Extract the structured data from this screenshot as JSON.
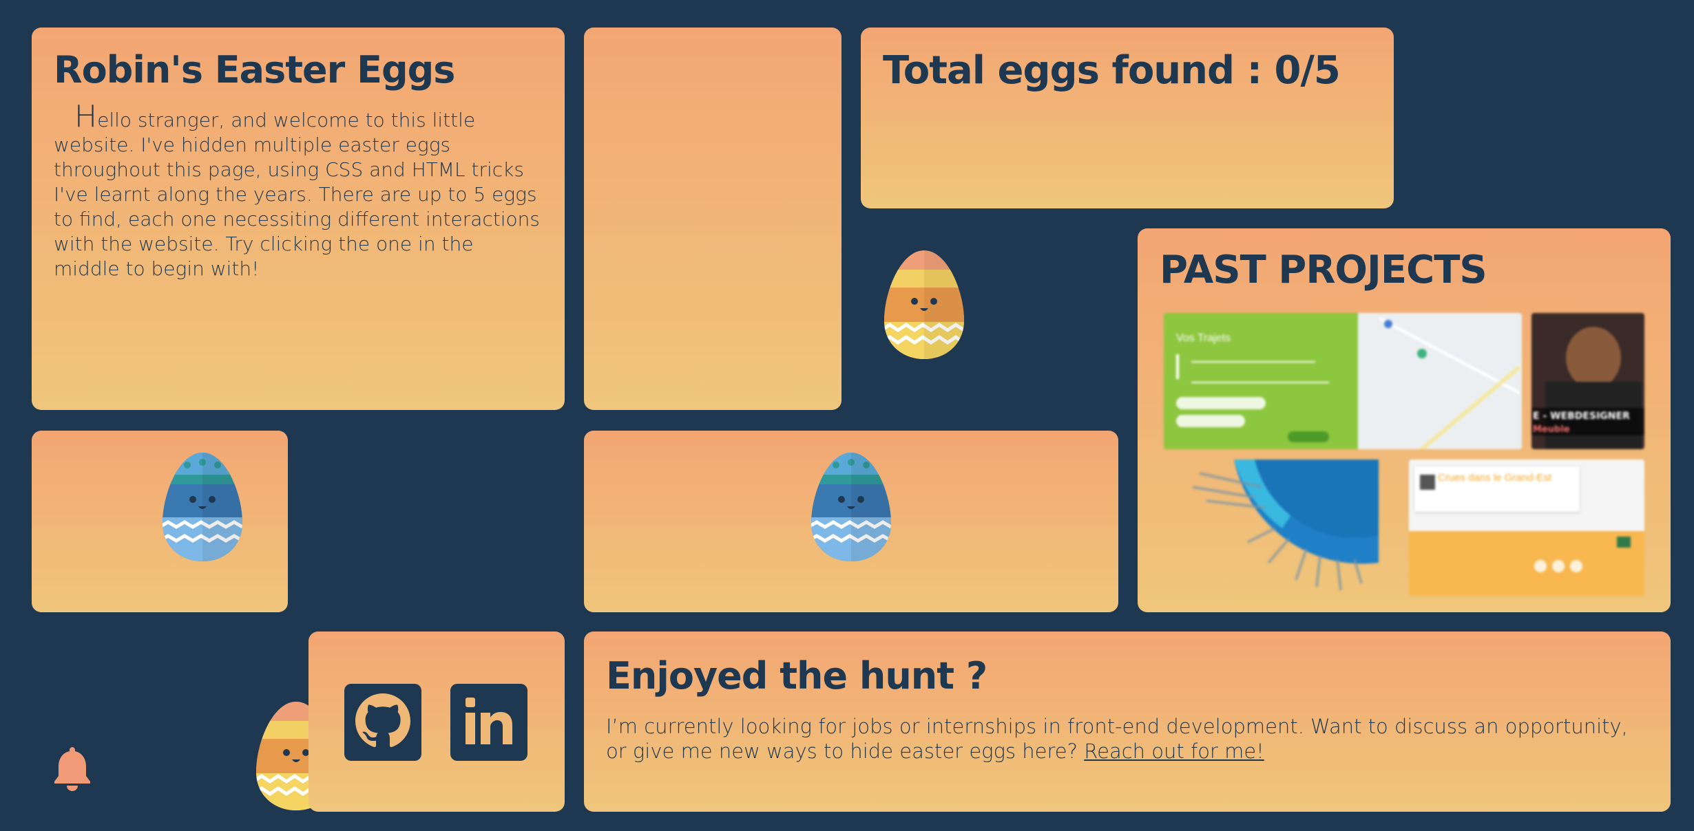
{
  "intro": {
    "title": "Robin's Easter Eggs",
    "dropcap": "H",
    "text": "ello stranger, and welcome to this little website. I've hidden multiple easter eggs throughout this page, using CSS and HTML tricks I've learnt along the years. There are up to 5 eggs to find, each one necessiting different interactions with the website. Try clicking the one in the middle to begin with!"
  },
  "counter": {
    "title": "Total eggs found : 0/5",
    "found": 0,
    "total": 5
  },
  "projects": {
    "title": "PAST PROJECTS",
    "trajets_title": "Vos Trajets",
    "webdesigner_label": "E - WEBDESIGNER",
    "webdesigner_sub": "Meuble",
    "crues_title": "Crues dans le Grand-Est"
  },
  "contact": {
    "title": "Enjoyed the hunt ?",
    "text": "I’m currently looking for jobs or internships in front-end development. Want to discuss an opportunity, or give me new ways to hide easter eggs here?",
    "link_label": "Reach out for me!"
  },
  "icons": {
    "github": "github-icon",
    "linkedin": "linkedin-icon",
    "bell": "bell-icon",
    "egg_blue": "egg-blue-icon",
    "egg_orange": "egg-orange-icon"
  },
  "colors": {
    "background": "#1d3850",
    "card_top": "#f3a673",
    "card_bottom": "#efc67b",
    "text": "#1d3850"
  }
}
